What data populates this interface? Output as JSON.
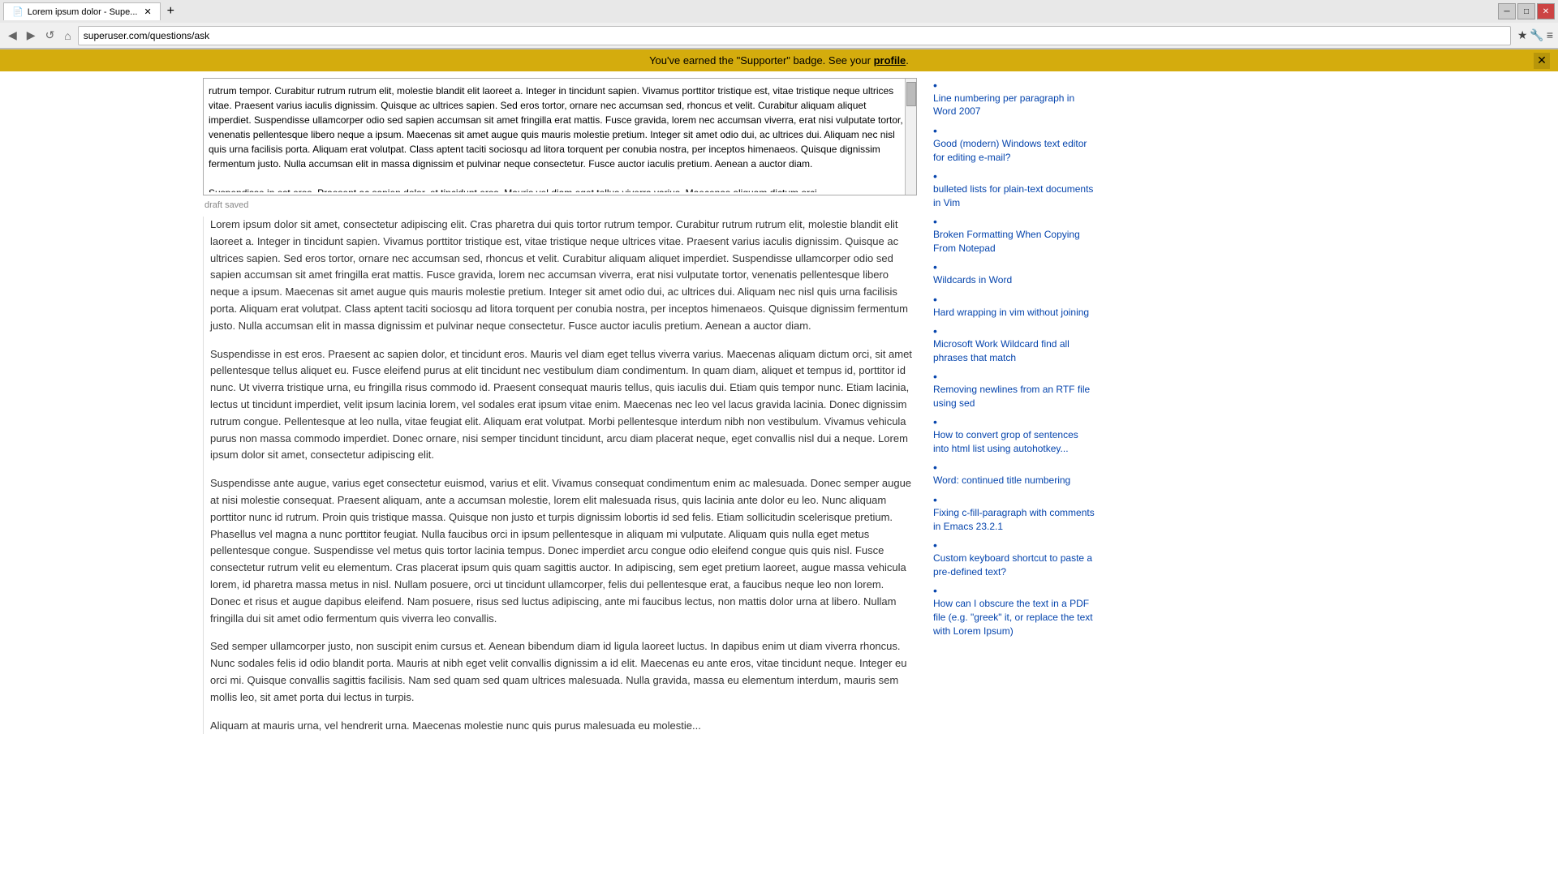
{
  "browser": {
    "tab_title": "Lorem ipsum dolor - Supe...",
    "tab_favicon": "📄",
    "url": "superuser.com/questions/ask",
    "new_tab_label": "+",
    "nav_back": "◀",
    "nav_forward": "▶",
    "nav_refresh": "↺",
    "nav_home": "⌂",
    "window_minimize": "─",
    "window_maximize": "□",
    "window_close": "✕"
  },
  "notification": {
    "text_before": "You've earned the \"Supporter\" badge. See your ",
    "link_text": "profile",
    "text_after": ".",
    "close_label": "✕"
  },
  "editor": {
    "content": "rutrum tempor. Curabitur rutrum rutrum elit, molestie blandit elit laoreet a. Integer in tincidunt sapien. Vivamus porttitor tristique est, vitae tristique neque ultrices vitae. Praesent varius iaculis dignissim. Quisque ac ultrices sapien. Sed eros tortor, ornare nec accumsan sed, rhoncus et velit. Curabitur aliquam aliquet imperdiet. Suspendisse ullamcorper odio sed sapien accumsan sit amet fringilla erat mattis. Fusce gravida, lorem nec accumsan viverra, erat nisi vulputate tortor, venenatis pellentesque libero neque a ipsum. Maecenas sit amet augue quis mauris molestie pretium. Integer sit amet odio dui, ac ultrices dui. Aliquam nec nisl quis urna facilisis porta. Aliquam erat volutpat. Class aptent taciti sociosqu ad litora torquent per conubia nostra, per inceptos himenaeos. Quisque dignissim fermentum justo. Nulla accumsan elit in massa dignissim et pulvinar neque consectetur. Fusce auctor iaculis pretium. Aenean a auctor diam.\n\nSuspendisse in est eros. Praesent ac sapien dolor, et tincidunt eros. Mauris vel diam eget tellus viverra varius. Maecenas aliquam dictum orci.",
    "draft_saved": "draft saved"
  },
  "answer": {
    "paragraphs": [
      "Lorem ipsum dolor sit amet, consectetur adipiscing elit. Cras pharetra dui quis tortor rutrum tempor. Curabitur rutrum rutrum elit, molestie blandit elit laoreet a. Integer in tincidunt sapien. Vivamus porttitor tristique est, vitae tristique neque ultrices vitae. Praesent varius iaculis dignissim. Quisque ac ultrices sapien. Sed eros tortor, ornare nec accumsan sed, rhoncus et velit. Curabitur aliquam aliquet imperdiet. Suspendisse ullamcorper odio sed sapien accumsan sit amet fringilla erat mattis. Fusce gravida, lorem nec accumsan viverra, erat nisi vulputate tortor, venenatis pellentesque libero neque a ipsum. Maecenas sit amet augue quis mauris molestie pretium. Integer sit amet odio dui, ac ultrices dui. Aliquam nec nisl quis urna facilisis porta. Aliquam erat volutpat. Class aptent taciti sociosqu ad litora torquent per conubia nostra, per inceptos himenaeos. Quisque dignissim fermentum justo. Nulla accumsan elit in massa dignissim et pulvinar neque consectetur. Fusce auctor iaculis pretium. Aenean a auctor diam.",
      "Suspendisse in est eros. Praesent ac sapien dolor, et tincidunt eros. Mauris vel diam eget tellus viverra varius. Maecenas aliquam dictum orci, sit amet pellentesque tellus aliquet eu. Fusce eleifend purus at elit tincidunt nec vestibulum diam condimentum. In quam diam, aliquet et tempus id, porttitor id nunc. Ut viverra tristique urna, eu fringilla risus commodo id. Praesent consequat mauris tellus, quis iaculis dui. Etiam quis tempor nunc. Etiam lacinia, lectus ut tincidunt imperdiet, velit ipsum lacinia lorem, vel sodales erat ipsum vitae enim. Maecenas nec leo vel lacus gravida lacinia. Donec dignissim rutrum congue. Pellentesque at leo nulla, vitae feugiat elit. Aliquam erat volutpat. Morbi pellentesque interdum nibh non vestibulum. Vivamus vehicula purus non massa commodo imperdiet. Donec ornare, nisi semper tincidunt tincidunt, arcu diam placerat neque, eget convallis nisl dui a neque. Lorem ipsum dolor sit amet, consectetur adipiscing elit.",
      "Suspendisse ante augue, varius eget consectetur euismod, varius et elit. Vivamus consequat condimentum enim ac malesuada. Donec semper augue at nisi molestie consequat. Praesent aliquam, ante a accumsan molestie, lorem elit malesuada risus, quis lacinia ante dolor eu leo. Nunc aliquam porttitor nunc id rutrum. Proin quis tristique massa. Quisque non justo et turpis dignissim lobortis id sed felis. Etiam sollicitudin scelerisque pretium. Phasellus vel magna a nunc porttitor feugiat. Nulla faucibus orci in ipsum pellentesque in aliquam mi vulputate. Aliquam quis nulla eget metus pellentesque congue. Suspendisse vel metus quis tortor lacinia tempus. Donec imperdiet arcu congue odio eleifend congue quis quis nisl. Fusce consectetur rutrum velit eu elementum. Cras placerat ipsum quis quam sagittis auctor. In adipiscing, sem eget pretium laoreet, augue massa vehicula lorem, id pharetra massa metus in nisl. Nullam posuere, orci ut tincidunt ullamcorper, felis dui pellentesque erat, a faucibus neque leo non lorem. Donec et risus et augue dapibus eleifend. Nam posuere, risus sed luctus adipiscing, ante mi faucibus lectus, non mattis dolor urna at libero. Nullam fringilla dui sit amet odio fermentum quis viverra leo convallis.",
      "Sed semper ullamcorper justo, non suscipit enim cursus et. Aenean bibendum diam id ligula laoreet luctus. In dapibus enim ut diam viverra rhoncus. Nunc sodales felis id odio blandit porta. Mauris at nibh eget velit convallis dignissim a id elit. Maecenas eu ante eros, vitae tincidunt neque. Integer eu orci mi. Quisque convallis sagittis facilisis. Nam sed quam sed quam ultrices malesuada. Nulla gravida, massa eu elementum interdum, mauris sem mollis leo, sit amet porta dui lectus in turpis.",
      "Aliquam at mauris urna, vel hendrerit urna. Maecenas molestie nunc quis purus malesuada eu molestie..."
    ]
  },
  "sidebar": {
    "links": [
      {
        "text": "Line numbering per paragraph in Word 2007"
      },
      {
        "text": "Good (modern) Windows text editor for editing e-mail?"
      },
      {
        "text": "bulleted lists for plain-text documents in Vim"
      },
      {
        "text": "Broken Formatting When Copying From Notepad"
      },
      {
        "text": "Wildcards in Word"
      },
      {
        "text": "Hard wrapping in vim without joining"
      },
      {
        "text": "Microsoft Work Wildcard find all phrases that match"
      },
      {
        "text": "Removing newlines from an RTF file using sed"
      },
      {
        "text": "How to convert grop of sentences into html list using autohotkey..."
      },
      {
        "text": "Word: continued title numbering"
      },
      {
        "text": "Fixing c-fill-paragraph with comments in Emacs 23.2.1"
      },
      {
        "text": "Custom keyboard shortcut to paste a pre-defined text?"
      },
      {
        "text": "How can I obscure the text in a PDF file (e.g. \"greek\" it, or replace the text with Lorem Ipsum)"
      }
    ]
  }
}
